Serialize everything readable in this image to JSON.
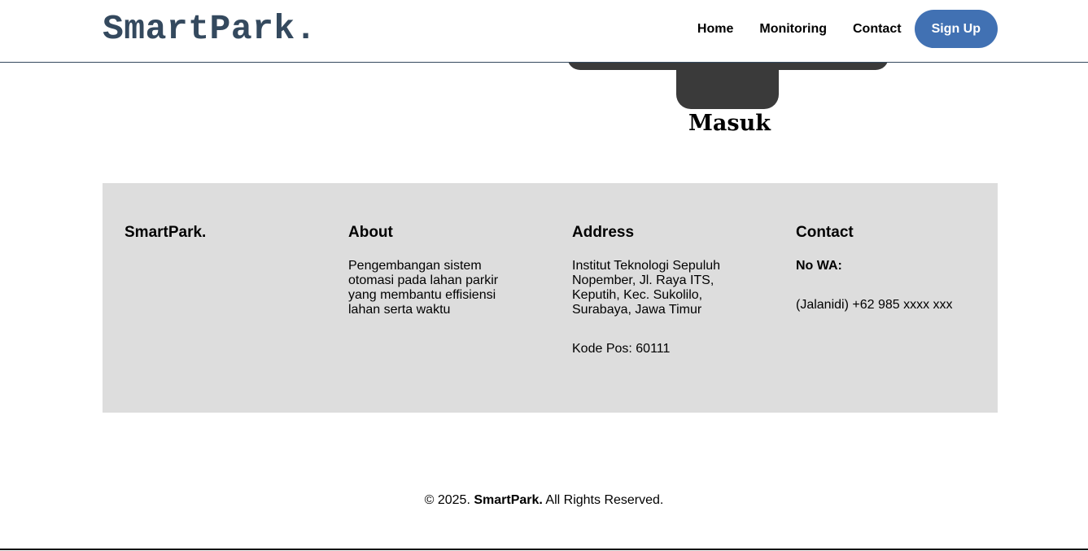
{
  "header": {
    "logo": "SmartPark.",
    "nav": {
      "home": "Home",
      "monitoring": "Monitoring",
      "contact": "Contact"
    },
    "signup": "Sign Up"
  },
  "main": {
    "gate_label": "Masuk"
  },
  "footer": {
    "brand": "SmartPark.",
    "about": {
      "title": "About",
      "text": "Pengembangan sistem otomasi pada lahan parkir yang membantu effisiensi lahan serta waktu"
    },
    "address": {
      "title": "Address",
      "text": "Institut Teknologi Sepuluh Nopember, Jl. Raya ITS, Keputih, Kec. Sukolilo, Surabaya, Jawa Timur",
      "postal": "Kode Pos: 60111"
    },
    "contact": {
      "title": "Contact",
      "wa_label": "No WA:",
      "wa_number": "(Jalanidi) +62 985 xxxx xxx"
    }
  },
  "copyright": {
    "prefix": "© 2025.",
    "brand": "SmartPark.",
    "suffix": "All Rights Reserved."
  },
  "colors": {
    "brand": "#34495e",
    "accent": "#4171b3",
    "footer_bg": "#dddddd",
    "gate": "#3a3a3a"
  }
}
